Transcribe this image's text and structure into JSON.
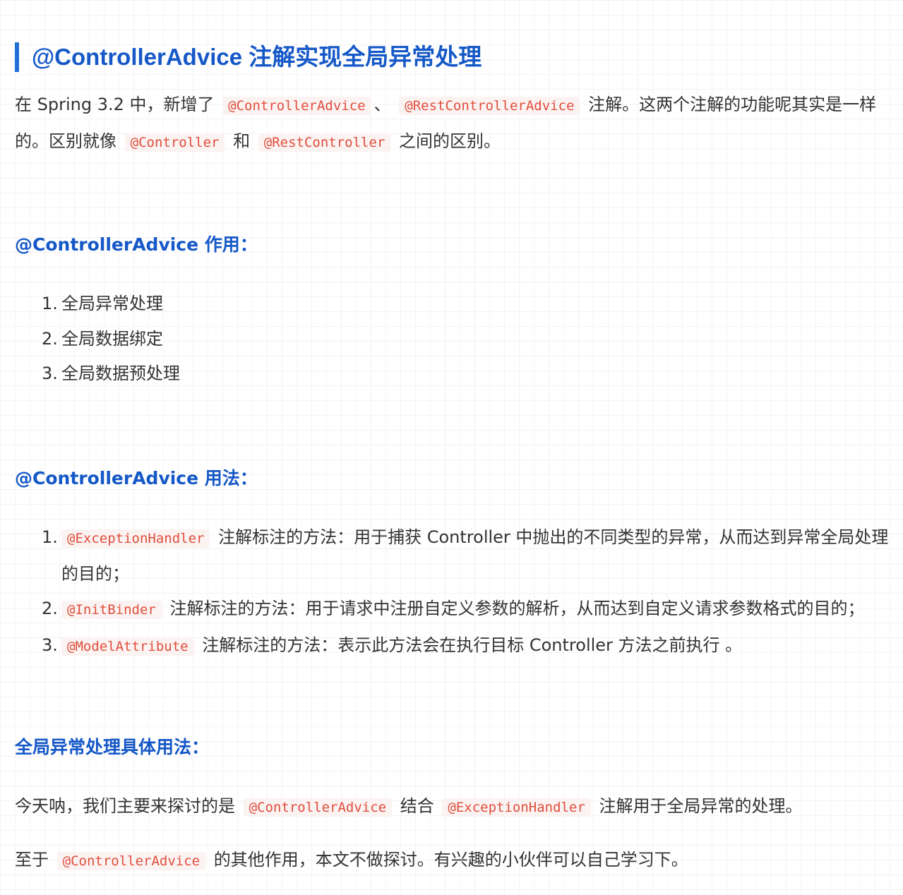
{
  "title": "@ControllerAdvice 注解实现全局异常处理",
  "intro": {
    "t1": "在 Spring 3.2 中，新增了",
    "code1": "@ControllerAdvice",
    "sep1": "、",
    "code2": "@RestControllerAdvice",
    "t2": "注解。这两个注解的功能呢其实是一样的。区别就像",
    "code3": "@Controller",
    "t3": "和",
    "code4": "@RestController",
    "t4": "之间的区别。"
  },
  "section_purpose": {
    "heading": "@ControllerAdvice 作用：",
    "items": [
      {
        "num": "1.",
        "text": "全局异常处理"
      },
      {
        "num": "2.",
        "text": "全局数据绑定"
      },
      {
        "num": "3.",
        "text": "全局数据预处理"
      }
    ]
  },
  "section_usage": {
    "heading": "@ControllerAdvice 用法：",
    "items": [
      {
        "num": "1.",
        "code": "@ExceptionHandler",
        "text": "注解标注的方法：用于捕获 Controller 中抛出的不同类型的异常，从而达到异常全局处理的目的；"
      },
      {
        "num": "2.",
        "code": "@InitBinder",
        "text": "注解标注的方法：用于请求中注册自定义参数的解析，从而达到自定义请求参数格式的目的；"
      },
      {
        "num": "3.",
        "code": "@ModelAttribute",
        "text": "注解标注的方法：表示此方法会在执行目标 Controller 方法之前执行 。"
      }
    ]
  },
  "section_detail": {
    "heading": "全局异常处理具体用法：",
    "p1": {
      "t1": "今天呐，我们主要来探讨的是",
      "code1": "@ControllerAdvice",
      "t2": "结合",
      "code2": "@ExceptionHandler",
      "t3": "注解用于全局异常的处理。"
    },
    "p2": {
      "t1": "至于",
      "code1": "@ControllerAdvice",
      "t2": "的其他作用，本文不做探讨。有兴趣的小伙伴可以自己学习下。"
    }
  },
  "colors": {
    "heading": "#1558c7",
    "accent_bar": "#1f6fd6",
    "body_text": "#333333",
    "code_text": "#e04e3c",
    "code_bg": "#fbf3f2"
  }
}
